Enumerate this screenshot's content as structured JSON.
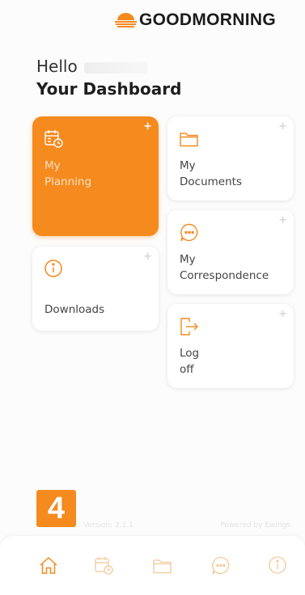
{
  "brand": {
    "name": "GOODMORNING",
    "accent": "#f58a1f"
  },
  "greeting": {
    "hello": "Hello",
    "title": "Your Dashboard"
  },
  "tiles": [
    {
      "id": "planning",
      "label_line1": "My",
      "label_line2": "Planning",
      "icon": "calendar-clock-icon",
      "active": true
    },
    {
      "id": "documents",
      "label_line1": "My",
      "label_line2": "Documents",
      "icon": "folder-icon"
    },
    {
      "id": "correspondence",
      "label_line1": "My",
      "label_line2": "Correspondence",
      "icon": "chat-bubble-icon"
    },
    {
      "id": "downloads",
      "label_line1": "Downloads",
      "icon": "info-icon"
    },
    {
      "id": "logoff",
      "label_line1": "Log",
      "label_line2": "off",
      "icon": "logout-icon"
    }
  ],
  "plus_symbol": "+",
  "footer": {
    "badge": "4",
    "version": "Version: 2.1.1",
    "powered": "Powered by Ewings"
  },
  "bottom_nav": [
    "home-icon",
    "calendar-clock-icon",
    "folder-icon",
    "chat-bubble-icon",
    "info-icon"
  ]
}
